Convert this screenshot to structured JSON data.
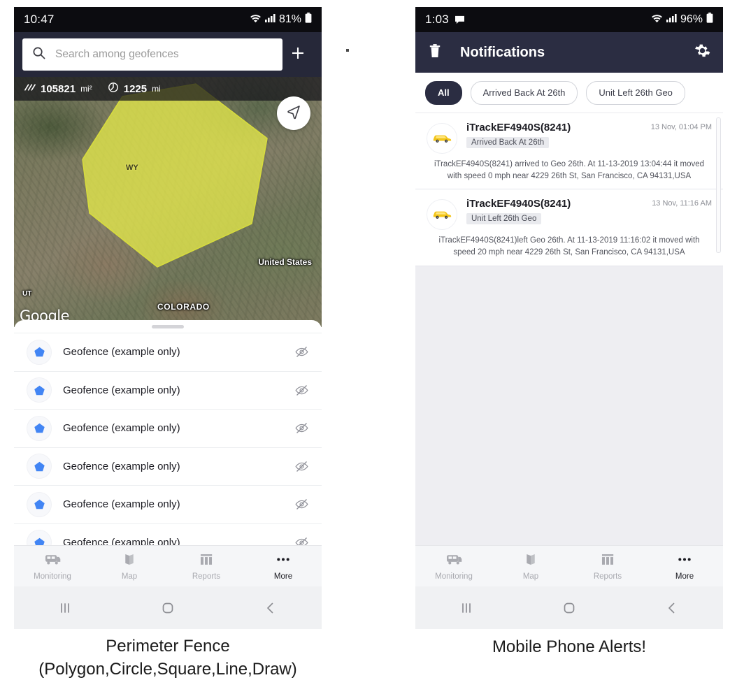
{
  "left_phone": {
    "status_bar": {
      "time": "10:47",
      "battery": "81%",
      "wifi_icon": "wifi-icon",
      "signal_icon": "cellular-signal-icon",
      "battery_icon": "battery-icon"
    },
    "search": {
      "placeholder": "Search among geofences",
      "value": "",
      "search_icon": "search-icon",
      "add_icon": "plus-icon"
    },
    "map": {
      "area_value": "105821",
      "area_unit": "mi²",
      "perimeter_value": "1225",
      "perimeter_unit": "mi",
      "area_icon": "area-hatch-icon",
      "perimeter_icon": "perimeter-clock-icon",
      "locate_icon": "navigation-arrow-icon",
      "labels": {
        "state_abbr": "WY",
        "country": "United States",
        "state": "COLORADO",
        "state2": "UT"
      },
      "attribution": "Google",
      "polygon_color": "#e3e84a"
    },
    "geofences": [
      {
        "name": "Geofence (example only)",
        "icon": "pentagon-icon",
        "visibility_icon": "eye-off-icon"
      },
      {
        "name": "Geofence (example only)",
        "icon": "pentagon-icon",
        "visibility_icon": "eye-off-icon"
      },
      {
        "name": "Geofence (example only)",
        "icon": "pentagon-icon",
        "visibility_icon": "eye-off-icon"
      },
      {
        "name": "Geofence (example only)",
        "icon": "pentagon-icon",
        "visibility_icon": "eye-off-icon"
      },
      {
        "name": "Geofence (example only)",
        "icon": "pentagon-icon",
        "visibility_icon": "eye-off-icon"
      },
      {
        "name": "Geofence (example only)",
        "icon": "pentagon-icon",
        "visibility_icon": "eye-off-icon"
      }
    ],
    "bottom_nav": [
      {
        "label": "Monitoring",
        "icon": "bus-icon",
        "active": false
      },
      {
        "label": "Map",
        "icon": "map-icon",
        "active": false
      },
      {
        "label": "Reports",
        "icon": "reports-icon",
        "active": false
      },
      {
        "label": "More",
        "icon": "more-dots-icon",
        "active": true
      }
    ],
    "system_nav": [
      {
        "icon": "recent-apps-icon"
      },
      {
        "icon": "home-icon"
      },
      {
        "icon": "back-icon"
      }
    ],
    "caption_line1": "Perimeter Fence",
    "caption_line2": "(Polygon,Circle,Square,Line,Draw)"
  },
  "right_phone": {
    "status_bar": {
      "time": "1:03",
      "battery": "96%",
      "message_icon": "message-icon",
      "wifi_icon": "wifi-icon",
      "signal_icon": "cellular-signal-icon",
      "battery_icon": "battery-icon"
    },
    "app_bar": {
      "title": "Notifications",
      "delete_icon": "trash-icon",
      "settings_icon": "gear-icon"
    },
    "filters": [
      {
        "label": "All",
        "active": true
      },
      {
        "label": "Arrived Back At 26th",
        "active": false
      },
      {
        "label": "Unit Left 26th Geo",
        "active": false
      }
    ],
    "notifications": [
      {
        "device": "iTrackEF4940S(8241)",
        "tag": "Arrived Back At 26th",
        "time": "13 Nov, 01:04 PM",
        "body": "iTrackEF4940S(8241) arrived to Geo 26th.    At 11-13-2019 13:04:44 it moved with speed 0 mph near 4229 26th St, San Francisco, CA 94131,USA",
        "avatar_icon": "yellow-car-icon"
      },
      {
        "device": "iTrackEF4940S(8241)",
        "tag": "Unit Left 26th Geo",
        "time": "13 Nov, 11:16 AM",
        "body": "iTrackEF4940S(8241)left Geo 26th.    At 11-13-2019 11:16:02 it moved with speed 20 mph near 4229 26th St, San Francisco, CA 94131,USA",
        "avatar_icon": "yellow-car-icon"
      }
    ],
    "bottom_nav": [
      {
        "label": "Monitoring",
        "icon": "bus-icon",
        "active": false
      },
      {
        "label": "Map",
        "icon": "map-icon",
        "active": false
      },
      {
        "label": "Reports",
        "icon": "reports-icon",
        "active": false
      },
      {
        "label": "More",
        "icon": "more-dots-icon",
        "active": true
      }
    ],
    "system_nav": [
      {
        "icon": "recent-apps-icon"
      },
      {
        "icon": "home-icon"
      },
      {
        "icon": "back-icon"
      }
    ],
    "caption": "Mobile Phone Alerts!"
  },
  "theme": {
    "status_bar_bg": "#0c0c10",
    "app_bar_bg": "#2b2d42",
    "search_bar_bg": "#262839",
    "accent_blue": "#4285f4",
    "polygon_yellow": "#e3e84a",
    "empty_bg": "#eeeef2"
  }
}
